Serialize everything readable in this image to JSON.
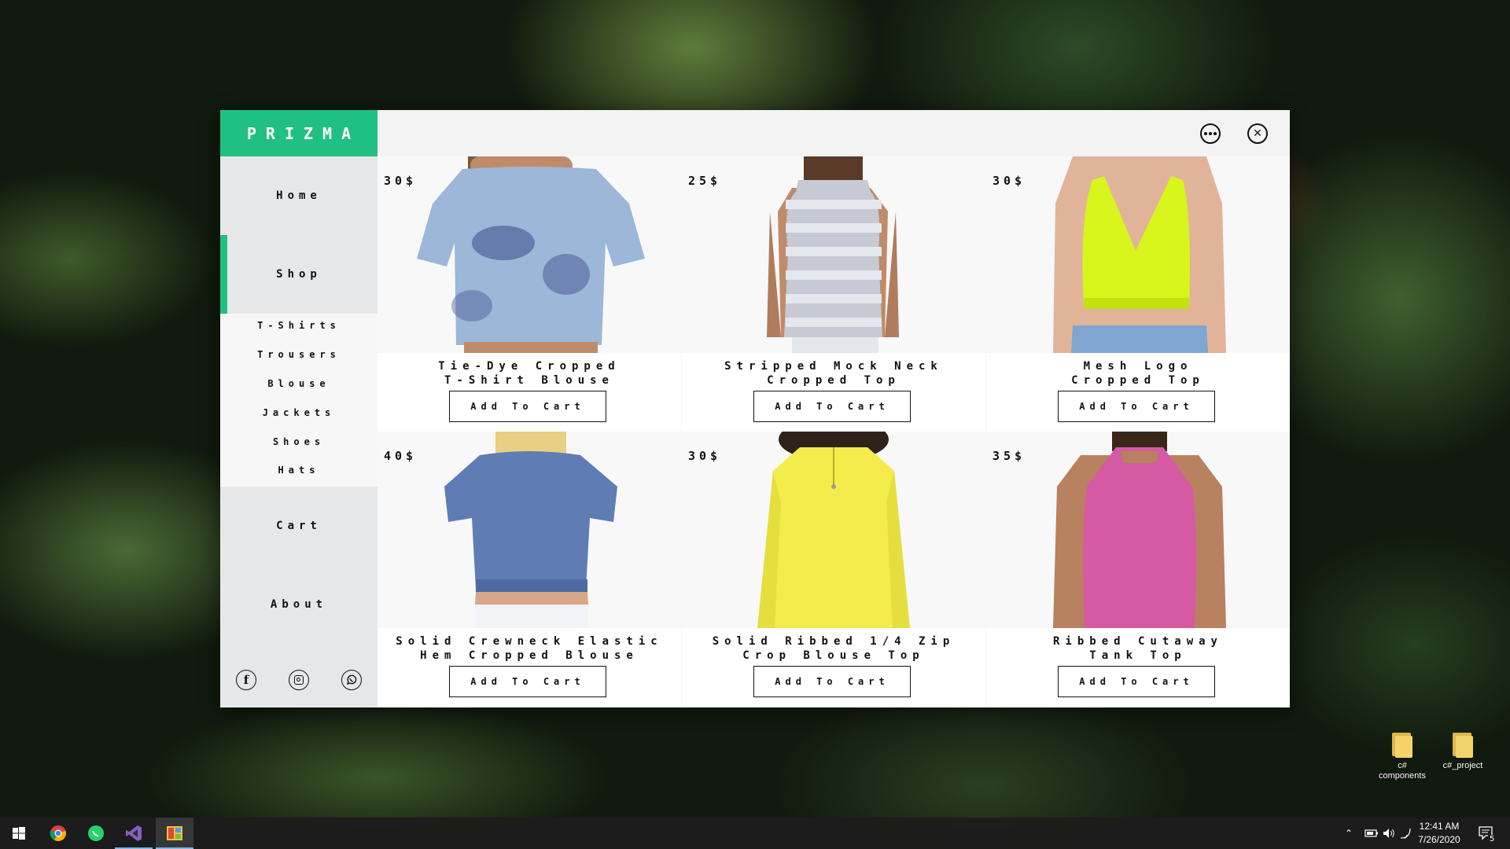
{
  "app": {
    "logo": "PRIZMA",
    "window_controls": {
      "more_icon": "more-icon",
      "close_icon": "close-icon"
    }
  },
  "sidebar": {
    "nav": [
      {
        "id": "home",
        "label": "Home"
      },
      {
        "id": "shop",
        "label": "Shop",
        "active": true
      },
      {
        "id": "cart",
        "label": "Cart"
      },
      {
        "id": "about",
        "label": "About"
      }
    ],
    "submenu": [
      "T-Shirts",
      "Trousers",
      "Blouse",
      "Jackets",
      "Shoes",
      "Hats"
    ],
    "social": [
      "facebook-icon",
      "instagram-icon",
      "whatsapp-icon"
    ],
    "accent_color": "#20c083"
  },
  "products": [
    {
      "price": "30$",
      "name_line1": "Tie-Dye Cropped",
      "name_line2": "T-Shirt Blouse",
      "button": "Add To Cart",
      "garment_color": "#9db7d8"
    },
    {
      "price": "25$",
      "name_line1": "Stripped Mock Neck",
      "name_line2": "Cropped Top",
      "button": "Add To Cart",
      "garment_color": "#c7c9d4"
    },
    {
      "price": "30$",
      "name_line1": "Mesh Logo",
      "name_line2": "Cropped Top",
      "button": "Add To Cart",
      "garment_color": "#d8f51c"
    },
    {
      "price": "40$",
      "name_line1": "Solid Crewneck Elastic",
      "name_line2": "Hem Cropped Blouse",
      "button": "Add To Cart",
      "garment_color": "#5f7cb4"
    },
    {
      "price": "30$",
      "name_line1": "Solid Ribbed 1/4 Zip",
      "name_line2": "Crop Blouse Top",
      "button": "Add To Cart",
      "garment_color": "#f3ec4a"
    },
    {
      "price": "35$",
      "name_line1": "Ribbed Cutaway",
      "name_line2": "Tank Top",
      "button": "Add To Cart",
      "garment_color": "#d65aa3"
    }
  ],
  "desktop": {
    "icons": [
      {
        "label_line1": "c#",
        "label_line2": "components"
      },
      {
        "label_line1": "c#_project",
        "label_line2": ""
      }
    ]
  },
  "taskbar": {
    "apps": [
      "windows-start-icon",
      "chrome-icon",
      "whatsapp-icon",
      "visual-studio-icon",
      "winforms-app-icon"
    ],
    "time": "12:41 AM",
    "date": "7/26/2020",
    "notifications": "5"
  }
}
